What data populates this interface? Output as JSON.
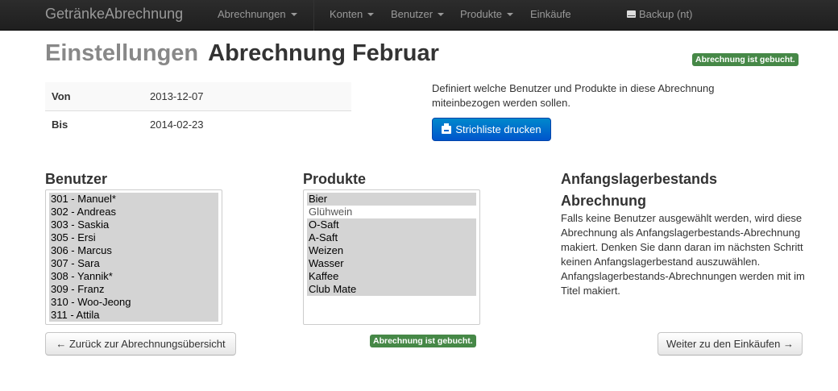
{
  "navbar": {
    "brand": "GetränkeAbrechnung",
    "items": [
      {
        "label": "Abrechnungen",
        "dropdown": true
      },
      {
        "label": "Konten",
        "dropdown": true
      },
      {
        "label": "Benutzer",
        "dropdown": true
      },
      {
        "label": "Produkte",
        "dropdown": true
      },
      {
        "label": "Einkäufe",
        "dropdown": false
      }
    ],
    "backup_label": "Backup (nt)"
  },
  "header": {
    "muted": "Einstellungen",
    "title": "Abrechnung Februar",
    "status_badge": "Abrechnung ist gebucht."
  },
  "dates": [
    {
      "key": "Von",
      "value": "2013-12-07"
    },
    {
      "key": "Bis",
      "value": "2014-02-23"
    }
  ],
  "description": "Definiert welche Benutzer und Produkte in diese Abrechnung miteinbezogen werden sollen.",
  "print_button": "Strichliste drucken",
  "users": {
    "heading": "Benutzer",
    "options": [
      {
        "label": "301 - Manuel*",
        "selected": true
      },
      {
        "label": "302 - Andreas",
        "selected": true
      },
      {
        "label": "303 - Saskia",
        "selected": true
      },
      {
        "label": "305 - Ersi",
        "selected": true
      },
      {
        "label": "306 - Marcus",
        "selected": true
      },
      {
        "label": "307 - Sara",
        "selected": true
      },
      {
        "label": "308 - Yannik*",
        "selected": true
      },
      {
        "label": "309 - Franz",
        "selected": true
      },
      {
        "label": "310 - Woo-Jeong",
        "selected": true
      },
      {
        "label": "311 - Attila",
        "selected": true
      }
    ]
  },
  "products": {
    "heading": "Produkte",
    "options": [
      {
        "label": "Bier",
        "selected": true
      },
      {
        "label": "Glühwein",
        "selected": false
      },
      {
        "label": "O-Saft",
        "selected": true
      },
      {
        "label": "A-Saft",
        "selected": true
      },
      {
        "label": "Weizen",
        "selected": true
      },
      {
        "label": "Wasser",
        "selected": true
      },
      {
        "label": "Kaffee",
        "selected": true
      },
      {
        "label": "Club Mate",
        "selected": true
      }
    ],
    "status_badge": "Abrechnung ist gebucht."
  },
  "info": {
    "heading_line1": "Anfangslagerbestands",
    "heading_line2": "Abrechnung",
    "text": "Falls keine Benutzer ausgewählt werden, wird diese Abrechnung als Anfangslagerbestands-Abrechnung makiert. Denken Sie dann daran im nächsten Schritt keinen Anfangslagerbestand auszuwählen. Anfangslagerbestands-Abrechnungen werden mit im Titel makiert."
  },
  "footer": {
    "back_button": "Zurück zur Abrechnungsübersicht",
    "next_button": "Weiter zu den Einkäufen"
  },
  "colors": {
    "navbar_bg": "#222222",
    "success": "#468847",
    "primary": "#0066cc"
  }
}
